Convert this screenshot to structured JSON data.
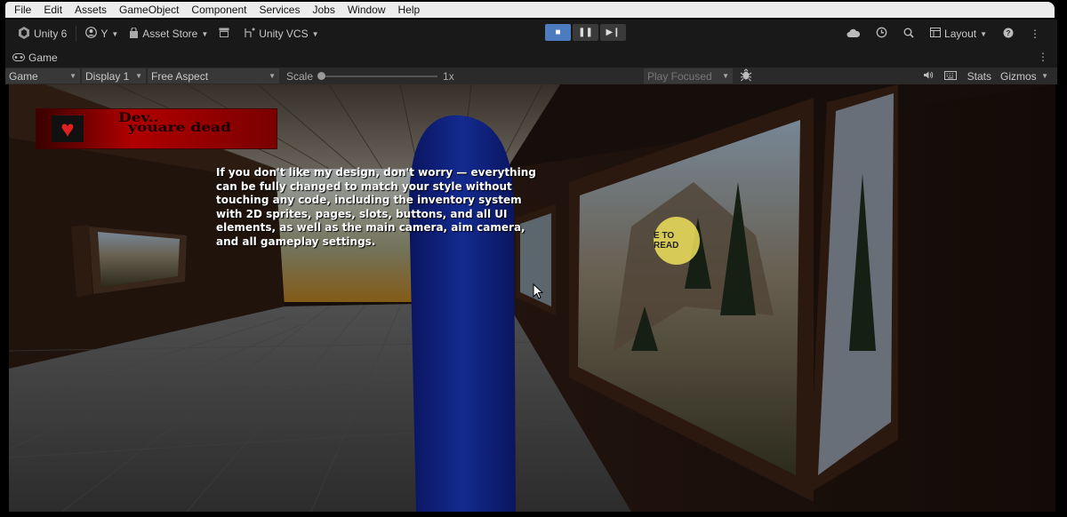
{
  "menu": [
    "File",
    "Edit",
    "Assets",
    "GameObject",
    "Component",
    "Services",
    "Jobs",
    "Window",
    "Help"
  ],
  "toolbar": {
    "unity_version": "Unity 6",
    "account": "Y",
    "asset_store": "Asset Store",
    "vcs": "Unity VCS",
    "layout": "Layout",
    "play_active_color": "#4c7bbf"
  },
  "tab": {
    "label": "Game"
  },
  "gamebar": {
    "mode": "Game",
    "display": "Display 1",
    "aspect": "Free Aspect",
    "scale_label": "Scale",
    "scale_value": "1x",
    "play_mode": "Play Focused",
    "stats": "Stats",
    "gizmos": "Gizmos"
  },
  "scene": {
    "banner_line1": "Dev..",
    "banner_line2": "youare dead",
    "overlay_text": "If you don't like my design, don't worry — everything can be fully changed to match your style without touching any code, including the inventory system with 2D sprites, pages, slots, buttons, and all UI elements, as well as the main camera, aim camera, and all gameplay settings.",
    "interact_prompt": "E TO READ",
    "colors": {
      "capsule": "#0f1e7a",
      "banner": "#b00000",
      "prompt": "#f0e15a"
    }
  }
}
